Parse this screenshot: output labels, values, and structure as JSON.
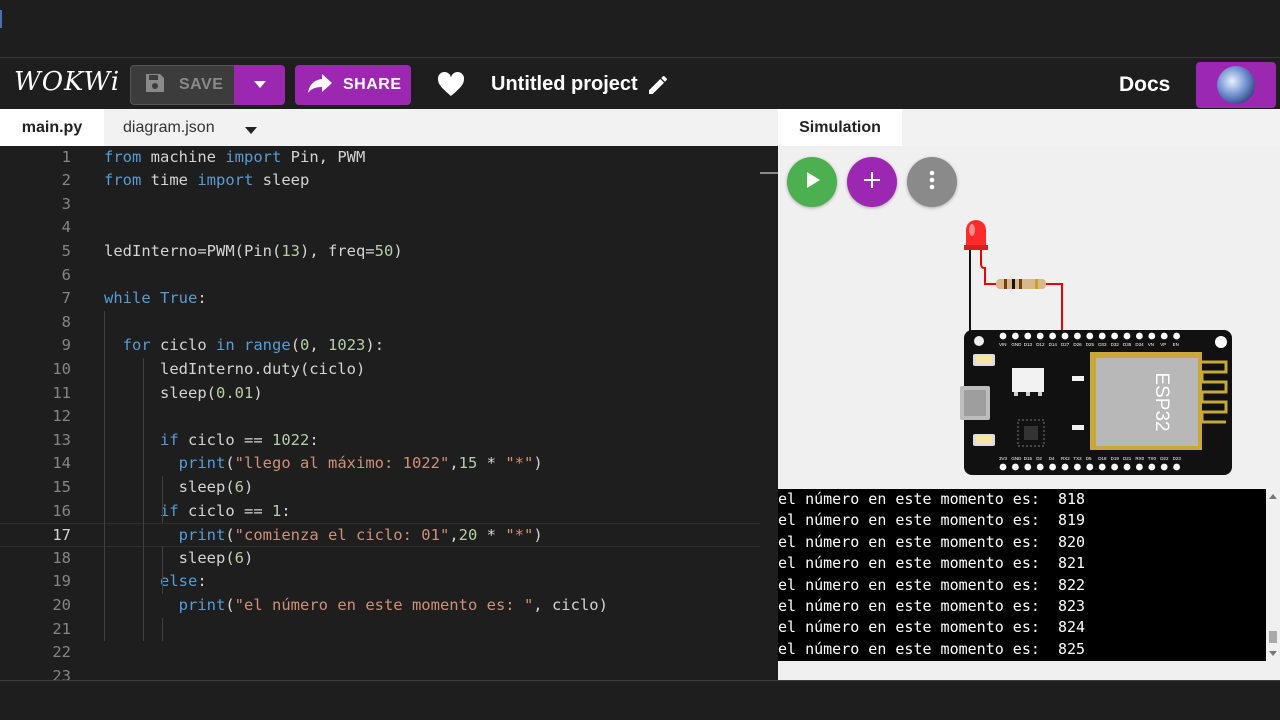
{
  "header": {
    "logo": "WOKWi",
    "save_label": "SAVE",
    "share_label": "SHARE",
    "project_title": "Untitled project",
    "docs_label": "Docs"
  },
  "editor": {
    "tabs": [
      {
        "label": "main.py",
        "active": true
      },
      {
        "label": "diagram.json",
        "active": false
      }
    ],
    "current_line": 17,
    "lines": [
      "from machine import Pin, PWM",
      "from time import sleep",
      "",
      "",
      "ledInterno=PWM(Pin(13), freq=50)",
      "",
      "while True:",
      "",
      "  for ciclo in range(0, 1023):",
      "      ledInterno.duty(ciclo)",
      "      sleep(0.01)",
      "",
      "      if ciclo == 1022:",
      "        print(\"llego al máximo: 1022\",15 * \"*\")",
      "        sleep(6)",
      "      if ciclo == 1:",
      "        print(\"comienza el ciclo: 01\",20 * \"*\")",
      "        sleep(6)",
      "      else:",
      "        print(\"el número en este momento es: \", ciclo)",
      "",
      "",
      ""
    ]
  },
  "simulation": {
    "tab_label": "Simulation",
    "chip_label": "ESP32",
    "pin_labels_top": [
      "VIN",
      "GND",
      "D13",
      "D12",
      "D14",
      "D27",
      "D26",
      "D25",
      "D33",
      "D32",
      "D35",
      "D34",
      "VN",
      "VP",
      "EN"
    ],
    "pin_labels_bottom": [
      "3V3",
      "GND",
      "D15",
      "D2",
      "D4",
      "RX2",
      "TX2",
      "D5",
      "D18",
      "D19",
      "D21",
      "RX0",
      "TX0",
      "D22",
      "D23"
    ]
  },
  "serial_monitor": {
    "lines": [
      "el número en este momento es:  818",
      "el número en este momento es:  819",
      "el número en este momento es:  820",
      "el número en este momento es:  821",
      "el número en este momento es:  822",
      "el número en este momento es:  823",
      "el número en este momento es:  824",
      "el número en este momento es:  825"
    ]
  },
  "colors": {
    "accent": "#9c27b0",
    "run": "#4caf50",
    "keyword": "#569cd6",
    "string": "#ce9178",
    "number": "#b5cea8"
  },
  "icons": {
    "save": "floppy-disk-icon",
    "share": "share-arrow-icon",
    "like": "heart-icon",
    "rename": "pencil-icon",
    "run": "play-icon",
    "add_part": "plus-icon",
    "more": "more-vertical-icon"
  }
}
